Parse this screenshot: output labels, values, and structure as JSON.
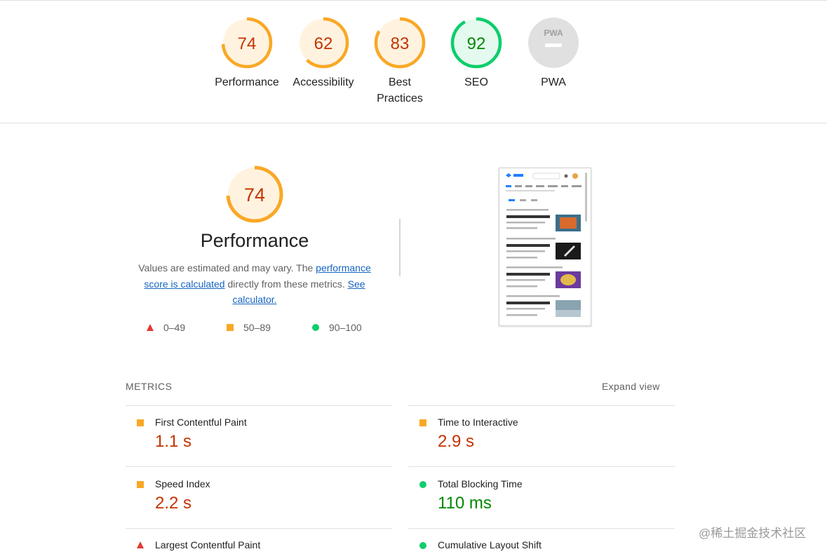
{
  "colors": {
    "fail": "#e53935",
    "average": "#f9a825",
    "pass": "#0cce6b",
    "average_text": "#c33300",
    "pass_text": "#008800",
    "link": "#1565c0"
  },
  "summary": {
    "categories": [
      {
        "label": "Performance",
        "score": "74",
        "score_value": 0.74,
        "rating": "average"
      },
      {
        "label": "Accessibility",
        "score": "62",
        "score_value": 0.62,
        "rating": "average"
      },
      {
        "label_line1": "Best",
        "label_line2": "Practices",
        "score": "83",
        "score_value": 0.83,
        "rating": "average"
      },
      {
        "label": "SEO",
        "score": "92",
        "score_value": 0.92,
        "rating": "pass"
      },
      {
        "label": "PWA",
        "badge": "PWA",
        "rating": "na"
      }
    ]
  },
  "performance": {
    "score": "74",
    "score_value": 0.74,
    "title": "Performance",
    "desc_text1": "Values are estimated and may vary. The ",
    "desc_link1": "performance score is calculated",
    "desc_text2": " directly from these metrics. ",
    "desc_link2": "See calculator.",
    "legend": [
      {
        "shape": "triangle",
        "range": "0–49"
      },
      {
        "shape": "square",
        "range": "50–89"
      },
      {
        "shape": "circle",
        "range": "90–100"
      }
    ]
  },
  "metrics": {
    "header": "METRICS",
    "expand_label": "Expand view",
    "items": [
      {
        "name": "First Contentful Paint",
        "value": "1.1 s",
        "rating": "average"
      },
      {
        "name": "Time to Interactive",
        "value": "2.9 s",
        "rating": "average"
      },
      {
        "name": "Speed Index",
        "value": "2.2 s",
        "rating": "average"
      },
      {
        "name": "Total Blocking Time",
        "value": "110 ms",
        "rating": "pass"
      },
      {
        "name": "Largest Contentful Paint",
        "value": "",
        "rating": "fail"
      },
      {
        "name": "Cumulative Layout Shift",
        "value": "",
        "rating": "pass"
      }
    ]
  },
  "watermark": "@稀土掘金技术社区"
}
